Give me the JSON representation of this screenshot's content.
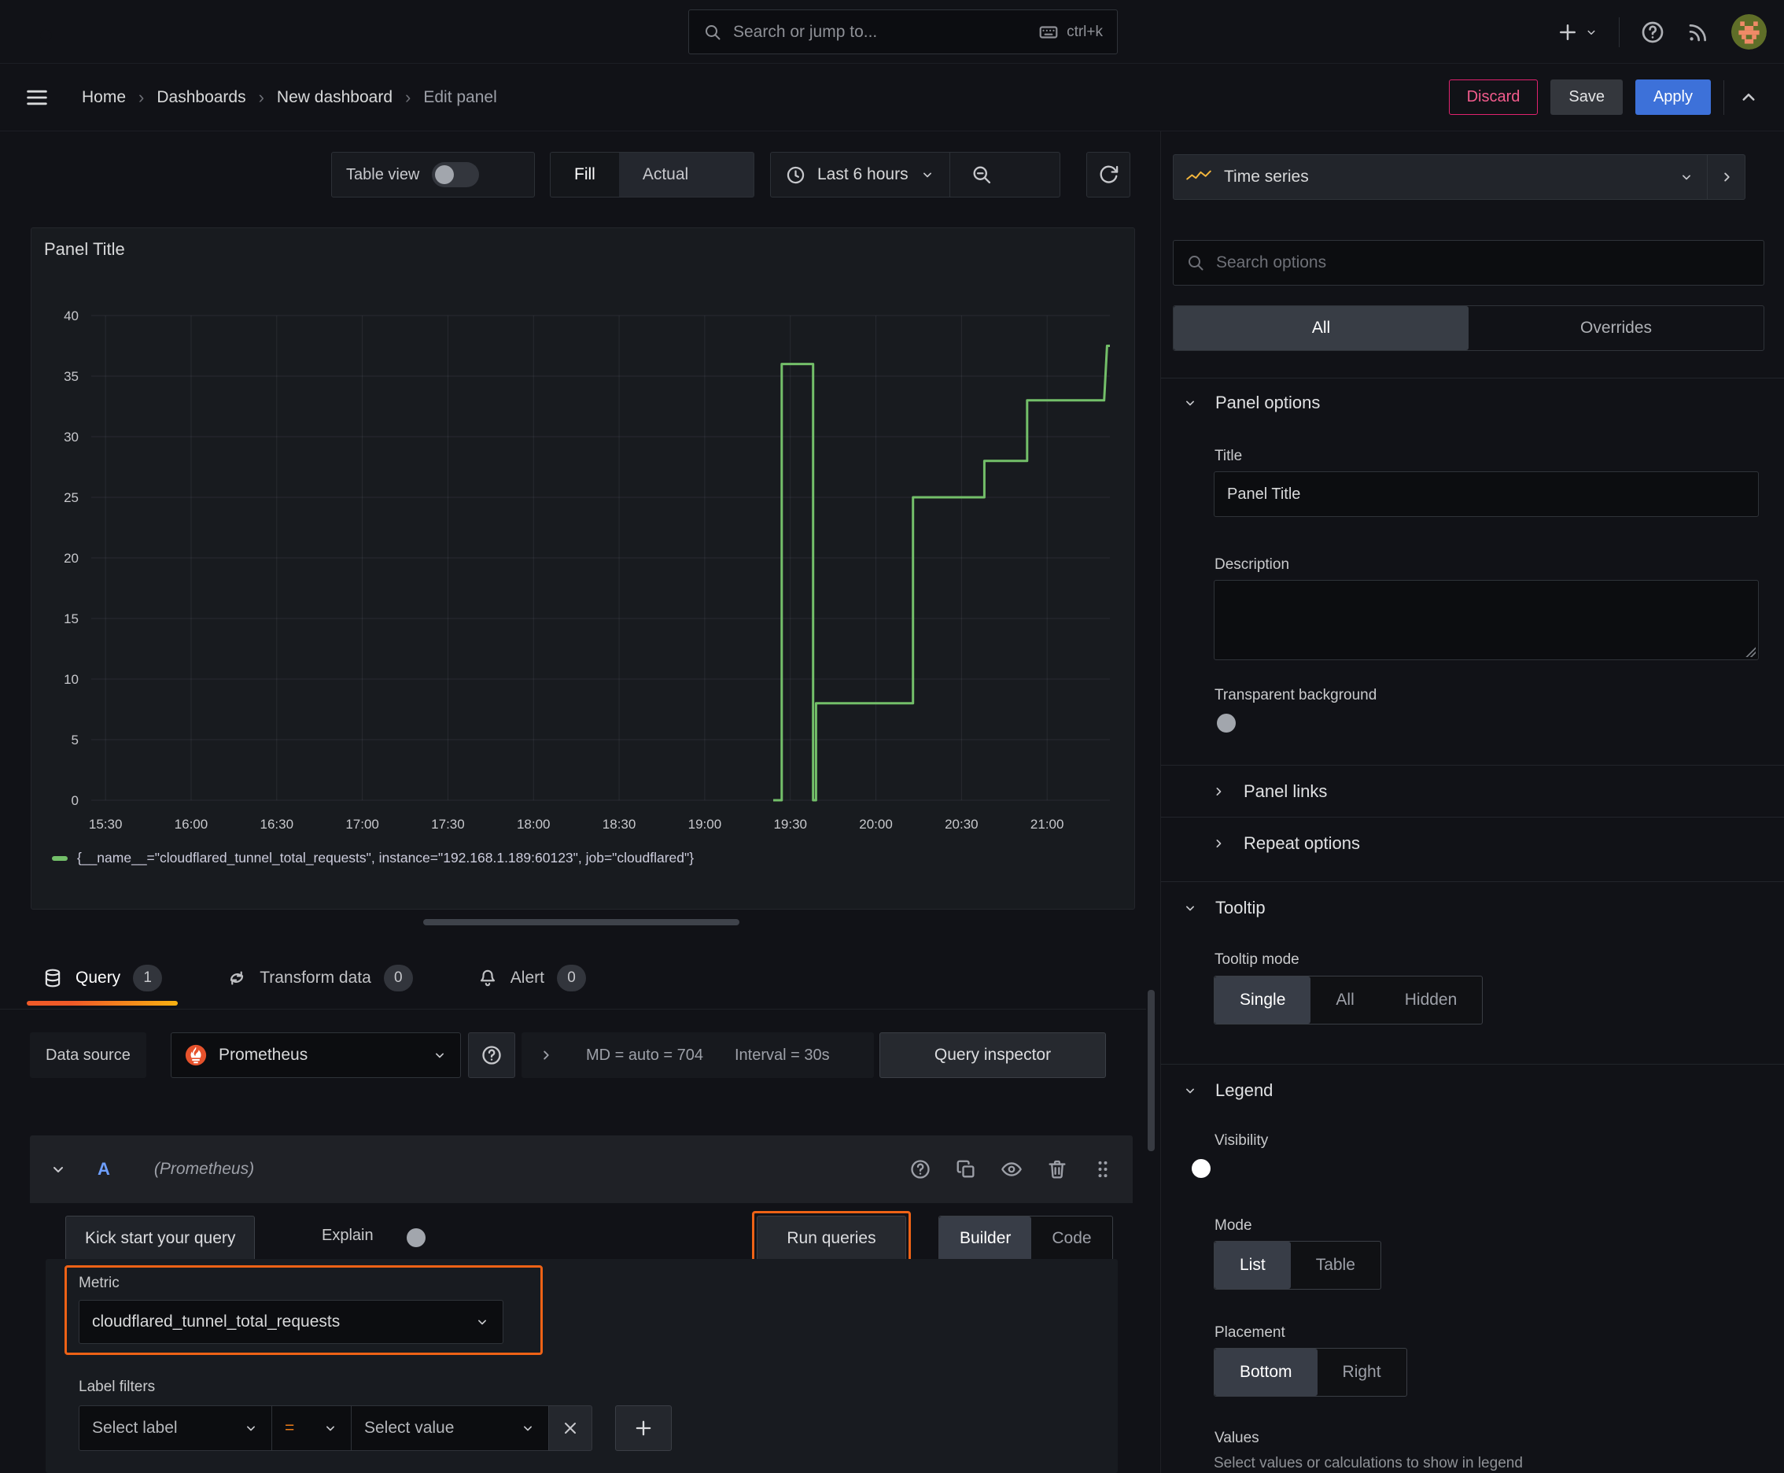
{
  "topbar": {
    "search_placeholder": "Search or jump to...",
    "shortcut": "ctrl+k"
  },
  "breadcrumb": {
    "items": [
      "Home",
      "Dashboards",
      "New dashboard",
      "Edit panel"
    ]
  },
  "actions": {
    "discard": "Discard",
    "save": "Save",
    "apply": "Apply"
  },
  "viz_toolbar": {
    "table_view": "Table view",
    "fill": "Fill",
    "actual": "Actual",
    "time_range": "Last 6 hours"
  },
  "panel": {
    "title": "Panel Title"
  },
  "chart_data": {
    "type": "line",
    "title": "Panel Title",
    "line_style": "step-after",
    "grid": true,
    "legend_position": "bottom",
    "ylim": [
      0,
      40
    ],
    "y_ticks": [
      0,
      5,
      10,
      15,
      20,
      25,
      30,
      35,
      40
    ],
    "x_start": "15:25",
    "x_end": "21:22",
    "x_ticks": [
      "15:30",
      "16:00",
      "16:30",
      "17:00",
      "17:30",
      "18:00",
      "18:30",
      "19:00",
      "19:30",
      "20:00",
      "20:30",
      "21:00"
    ],
    "series": [
      {
        "name": "{__name__=\"cloudflared_tunnel_total_requests\", instance=\"192.168.1.189:60123\", job=\"cloudflared\"}",
        "color": "#73bf69",
        "times": [
          "19:24",
          "19:27",
          "19:27",
          "19:38",
          "19:38",
          "19:39",
          "19:39",
          "20:13",
          "20:13",
          "20:38",
          "20:38",
          "20:53",
          "20:53",
          "21:20",
          "21:21",
          "21:22"
        ],
        "values": [
          0,
          0,
          36,
          36,
          0,
          0,
          8,
          8,
          25,
          25,
          28,
          28,
          33,
          33,
          37.5,
          37.5
        ]
      }
    ]
  },
  "tabs": [
    {
      "label": "Query",
      "badge": "1"
    },
    {
      "label": "Transform data",
      "badge": "0"
    },
    {
      "label": "Alert",
      "badge": "0"
    }
  ],
  "query": {
    "datasource_label": "Data source",
    "datasource_value": "Prometheus",
    "meta_md": "MD = auto = 704",
    "meta_interval": "Interval = 30s",
    "inspector_button": "Query inspector",
    "ref_id": "A",
    "ref_datasource": "(Prometheus)",
    "kickstart_button": "Kick start your query",
    "explain_label": "Explain",
    "run_button": "Run queries",
    "builder_label": "Builder",
    "code_label": "Code",
    "metric_label": "Metric",
    "metric_value": "cloudflared_tunnel_total_requests",
    "label_filters_label": "Label filters",
    "select_label_placeholder": "Select label",
    "operator": "=",
    "select_value_placeholder": "Select value"
  },
  "options_pane": {
    "viz_type": "Time series",
    "search_placeholder": "Search options",
    "filter_tabs": [
      "All",
      "Overrides"
    ],
    "sections": {
      "panel_options": "Panel options",
      "panel_links": "Panel links",
      "repeat_options": "Repeat options",
      "tooltip": "Tooltip",
      "legend": "Legend"
    },
    "fields": {
      "title_label": "Title",
      "title_value": "Panel Title",
      "description_label": "Description",
      "transparent_label": "Transparent background",
      "tooltip_mode_label": "Tooltip mode",
      "tooltip_modes": [
        "Single",
        "All",
        "Hidden"
      ],
      "visibility_label": "Visibility",
      "mode_label": "Mode",
      "mode_options": [
        "List",
        "Table"
      ],
      "placement_label": "Placement",
      "placement_options": [
        "Bottom",
        "Right"
      ],
      "values_label": "Values",
      "values_desc": "Select values or calculations to show in legend"
    }
  },
  "colors": {
    "accent_orange": "#f05a28",
    "highlight_outline": "#ee6216",
    "primary_blue": "#3d71d9",
    "danger_pink": "#e0226e",
    "series_green": "#73bf69"
  }
}
